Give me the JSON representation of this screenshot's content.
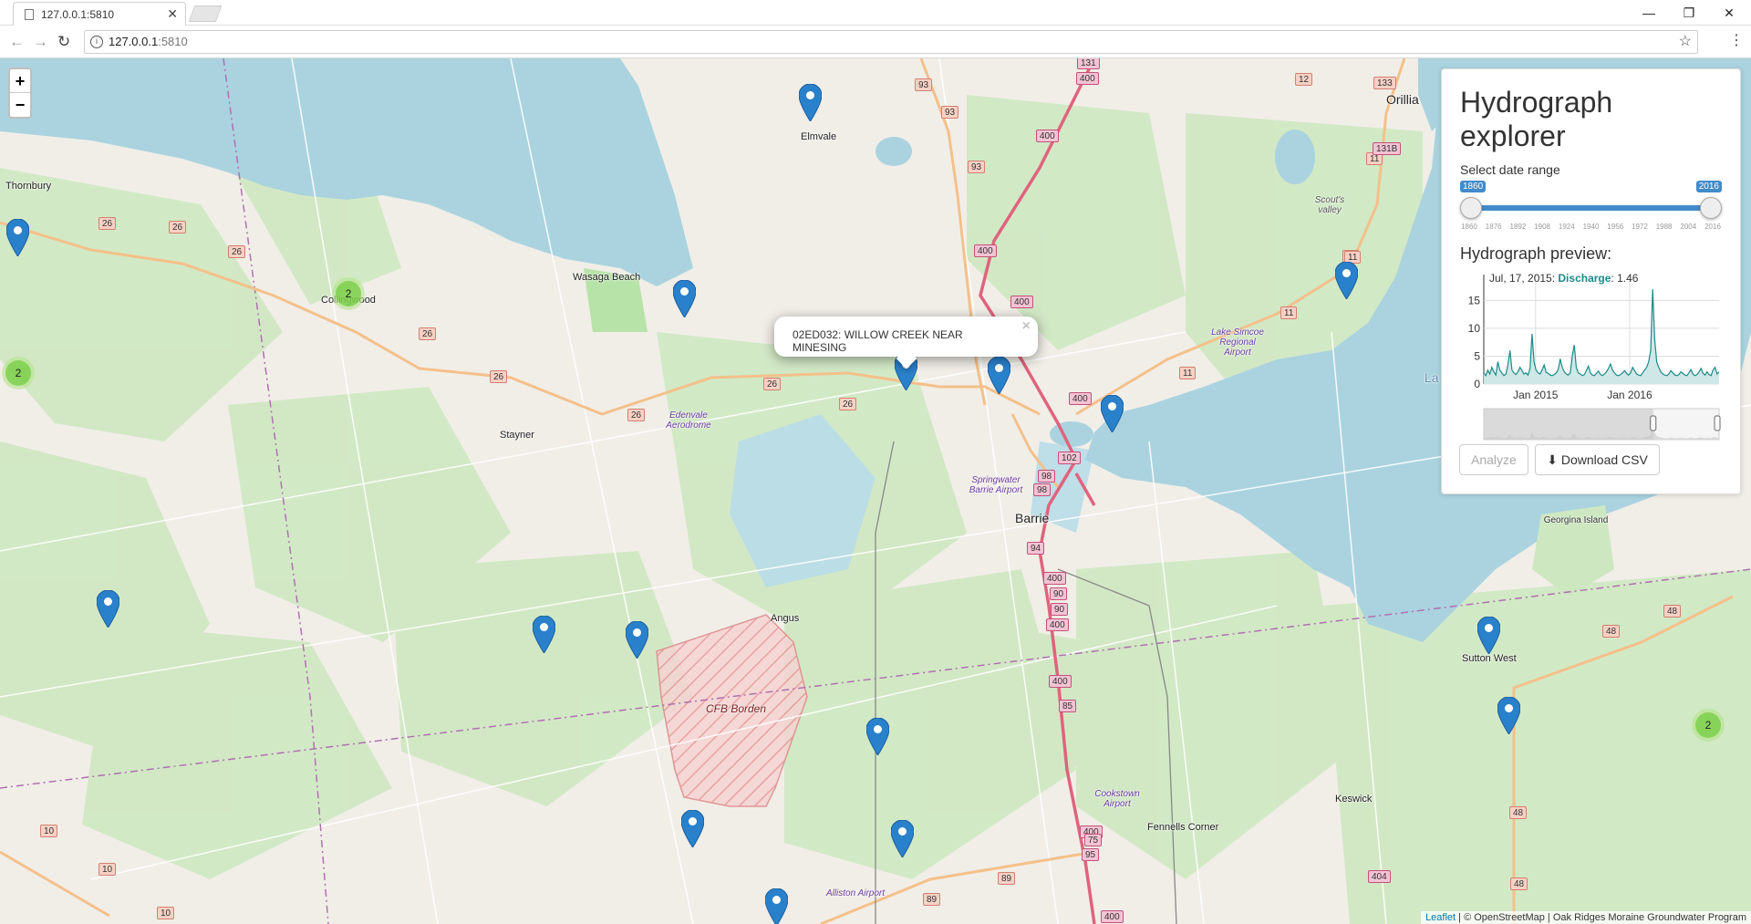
{
  "browser": {
    "tab_title": "127.0.0.1:5810",
    "url_host": "127.0.0.1",
    "url_port": ":5810"
  },
  "map": {
    "zoom_in": "+",
    "zoom_out": "−",
    "places": {
      "elmvale": "Elmvale",
      "thornbury": "Thornbury",
      "wasaga": "Wasaga Beach",
      "collingwood": "Collingwood",
      "stayner": "Stayner",
      "barrie": "Barrie",
      "angus": "Angus",
      "orillia": "Orillia",
      "sutton": "Sutton West",
      "keswick": "Keswick",
      "fennells": "Fennells Corner",
      "georgina": "Georgina Island",
      "scouts": "Scout's valley",
      "cfb": "CFB Borden",
      "lake": "La"
    },
    "airports": {
      "edenvale": "Edenvale Aerodrome",
      "springwater": "Springwater Barrie Airport",
      "simcoe": "Lake Simcoe Regional Airport",
      "cookstown": "Cookstown Airport",
      "alliston": "Alliston Airport"
    },
    "shields": [
      "93",
      "93",
      "93",
      "131",
      "400",
      "400",
      "400",
      "400",
      "400",
      "400",
      "400",
      "400",
      "400",
      "400",
      "26",
      "26",
      "26",
      "26",
      "26",
      "26",
      "26",
      "26",
      "12",
      "133",
      "11",
      "11",
      "11",
      "11",
      "11",
      "10",
      "10",
      "10",
      "89",
      "89",
      "48",
      "48",
      "48",
      "48",
      "404",
      "102",
      "98",
      "98",
      "94",
      "90",
      "90",
      "85",
      "75",
      "95",
      "131B"
    ],
    "clusters": [
      "2",
      "2",
      "2"
    ],
    "popup_text": "02ED032: WILLOW CREEK NEAR MINESING",
    "popup_close": "×",
    "attribution_link": "Leaflet",
    "attribution_text": " | © OpenStreetMap | Oak Ridges Moraine Groundwater Program"
  },
  "panel": {
    "title": "Hydrograph explorer",
    "date_label": "Select date range",
    "range_from": "1860",
    "range_to": "2016",
    "ticks": [
      "1860",
      "1876",
      "1892",
      "1908",
      "1924",
      "1940",
      "1956",
      "1972",
      "1988",
      "2004",
      "2016"
    ],
    "preview_heading": "Hydrograph preview:",
    "analyze_label": "Analyze",
    "download_label": "Download CSV"
  },
  "chart_data": {
    "type": "area",
    "tooltip_date": "Jul, 17, 2015:",
    "tooltip_series": "Discharge",
    "tooltip_value": ": 1.46",
    "x_ticks": [
      "Jan 2015",
      "Jan 2016"
    ],
    "y_ticks": [
      0,
      5,
      10,
      15
    ],
    "ylim": [
      0,
      18
    ],
    "xlabel": "",
    "ylabel": "",
    "series": [
      {
        "name": "Discharge",
        "color": "#1b8a87",
        "values": [
          2,
          1.5,
          2.5,
          1.8,
          3,
          2.2,
          1.6,
          4,
          2.5,
          2,
          1.5,
          1.8,
          3.5,
          6,
          2.5,
          2,
          1.7,
          2.2,
          3,
          2.4,
          1.8,
          2,
          1.6,
          2.8,
          9,
          4,
          2.5,
          2,
          1.8,
          2.5,
          3.4,
          2.1,
          1.9,
          1.6,
          1.5,
          1.7,
          2,
          2.6,
          4.5,
          3,
          2.2,
          1.8,
          1.6,
          2,
          5,
          7,
          3,
          2,
          1.8,
          1.5,
          1.7,
          2.4,
          3.2,
          2,
          1.6,
          1.5,
          1.9,
          2.3,
          1.7,
          1.5,
          1.8,
          2.2,
          2.8,
          3.6,
          2.5,
          2,
          1.6,
          1.5,
          1.7,
          2,
          2.4,
          1.9,
          1.6,
          2,
          3,
          2.4,
          1.8,
          1.6,
          1.5,
          2,
          2.5,
          3,
          4,
          6,
          17,
          8,
          4,
          3,
          2.2,
          1.8,
          1.6,
          1.5,
          1.8,
          2.4,
          2,
          1.6,
          1.5,
          1.7,
          2.2,
          1.9,
          1.6,
          1.5,
          2,
          2.6,
          1.8,
          1.5,
          1.7,
          2.1,
          2.8,
          1.9,
          1.6,
          2.2,
          1.7,
          1.5,
          2.5,
          3,
          1.8,
          2.2
        ]
      }
    ]
  }
}
